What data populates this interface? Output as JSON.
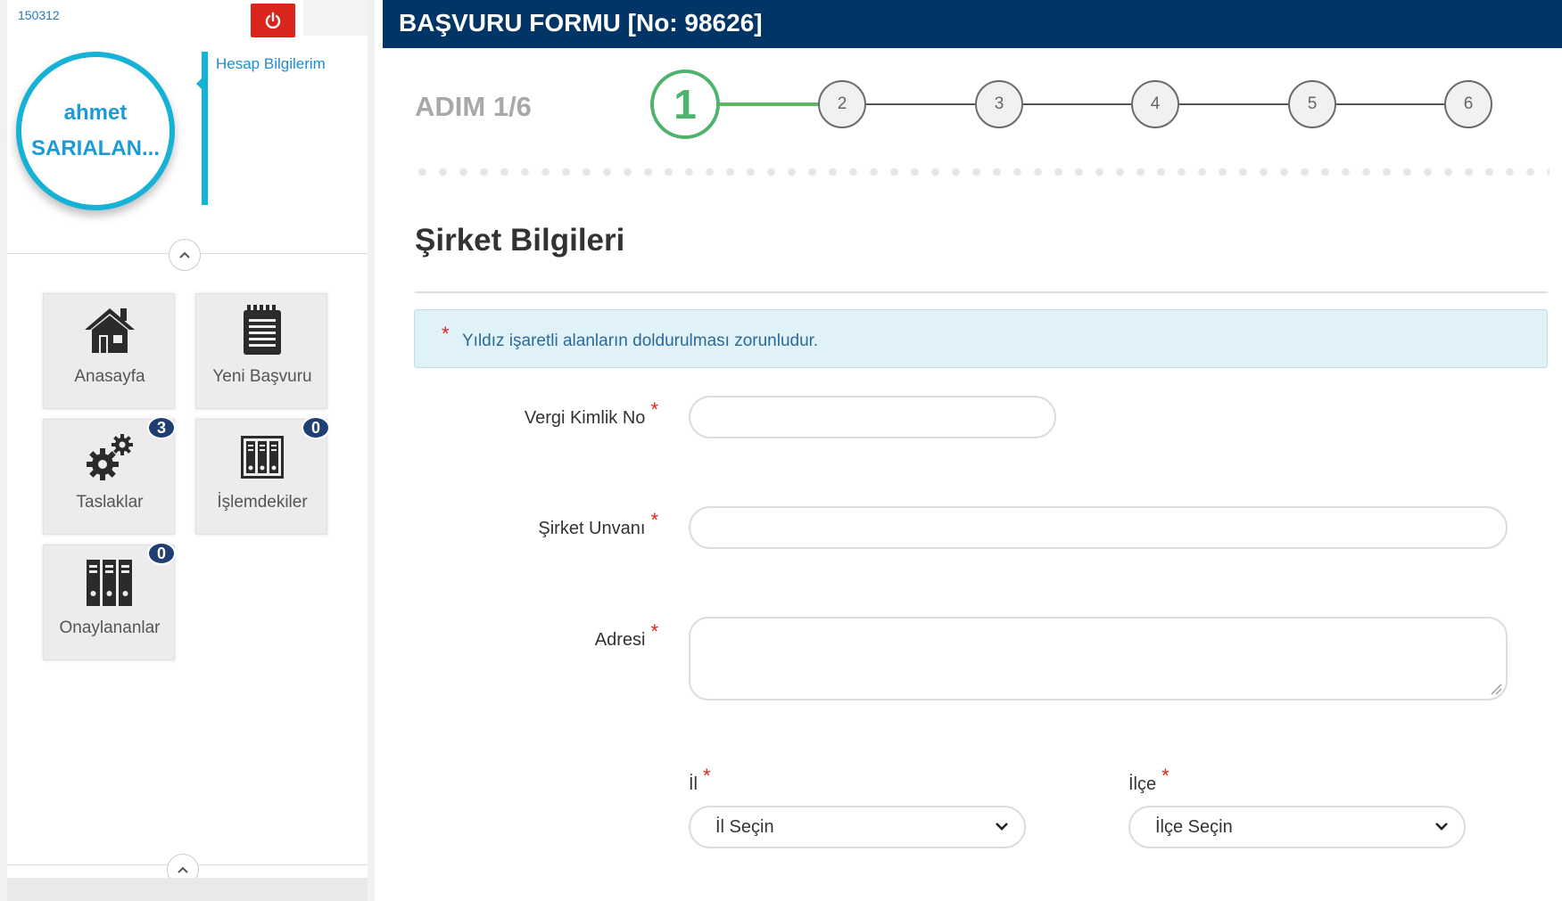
{
  "sidebar": {
    "user_code": "150312",
    "user_name_line1": "ahmet",
    "user_name_line2": "SARIALAN...",
    "account_link": "Hesap Bilgilerim",
    "tiles": [
      {
        "label": "Anasayfa",
        "icon": "house-icon",
        "badge": null
      },
      {
        "label": "Yeni Başvuru",
        "icon": "notepad-icon",
        "badge": null
      },
      {
        "label": "Taslaklar",
        "icon": "gears-icon",
        "badge": "3"
      },
      {
        "label": "İşlemdekiler",
        "icon": "file-cabinet-icon",
        "badge": "0"
      },
      {
        "label": "Onaylananlar",
        "icon": "binders-icon",
        "badge": "0"
      }
    ]
  },
  "header": {
    "title": "BAŞVURU FORMU [No: 98626]"
  },
  "stepper": {
    "step_title": "ADIM 1/6",
    "current": 1,
    "steps": [
      "1",
      "2",
      "3",
      "4",
      "5",
      "6"
    ]
  },
  "form": {
    "section_title": "Şirket Bilgileri",
    "notice_star": "*",
    "notice": "Yıldız işaretli alanların doldurulması zorunludur.",
    "required_mark": "*",
    "tax_id_label": "Vergi Kimlik No",
    "tax_id_value": "",
    "company_name_label": "Şirket Unvanı",
    "company_name_value": "",
    "address_label": "Adresi",
    "address_value": "",
    "province_label": "İl",
    "province_selected": "İl Seçin",
    "district_label": "İlçe",
    "district_selected": "İlçe Seçin"
  },
  "colors": {
    "header_bg": "#003565",
    "accent_cyan": "#16b2d6",
    "active_step_green": "#4fb36b",
    "power_red": "#d9251c",
    "badge_navy": "#1f3f73",
    "notice_bg": "#e0f1f7"
  }
}
